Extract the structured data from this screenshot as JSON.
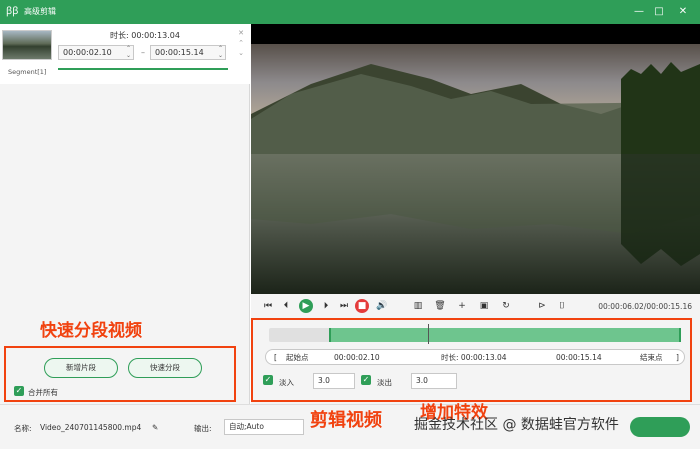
{
  "window": {
    "title": "高级剪辑",
    "logo": "ꞵꞵ",
    "controls": [
      "minimize-icon",
      "maximize-icon",
      "close-icon"
    ]
  },
  "segments": {
    "duration_label": "时长:",
    "duration_value": "00:00:13.04",
    "start": "00:00:02.10",
    "end": "00:00:15.14",
    "item_label": "Segment[1]"
  },
  "annotations": {
    "left": "快速分段视频",
    "bottom": "剪辑视频",
    "right": "增加特效"
  },
  "left_panel": {
    "new_segment": "新增片段",
    "quick_split": "快速分段",
    "merge_all": "合并所有"
  },
  "player": {
    "time_current": "00:00:06.02",
    "time_total": "00:00:15.16"
  },
  "trim": {
    "start_label": "起始点",
    "start_value": "00:00:02.10",
    "duration_label": "时长:",
    "duration_value": "00:00:13.04",
    "end_value": "00:00:15.14",
    "end_label": "结束点"
  },
  "effects": {
    "fade_in_label": "淡入",
    "fade_in_value": "3.0",
    "fade_out_label": "淡出",
    "fade_out_value": "3.0"
  },
  "bottom": {
    "name_label": "名称:",
    "name_value": "Video_240701145800.mp4",
    "output_label": "输出:",
    "output_value": "自动;Auto"
  },
  "watermark": "掘金技术社区 @ 数据蛙官方软件"
}
